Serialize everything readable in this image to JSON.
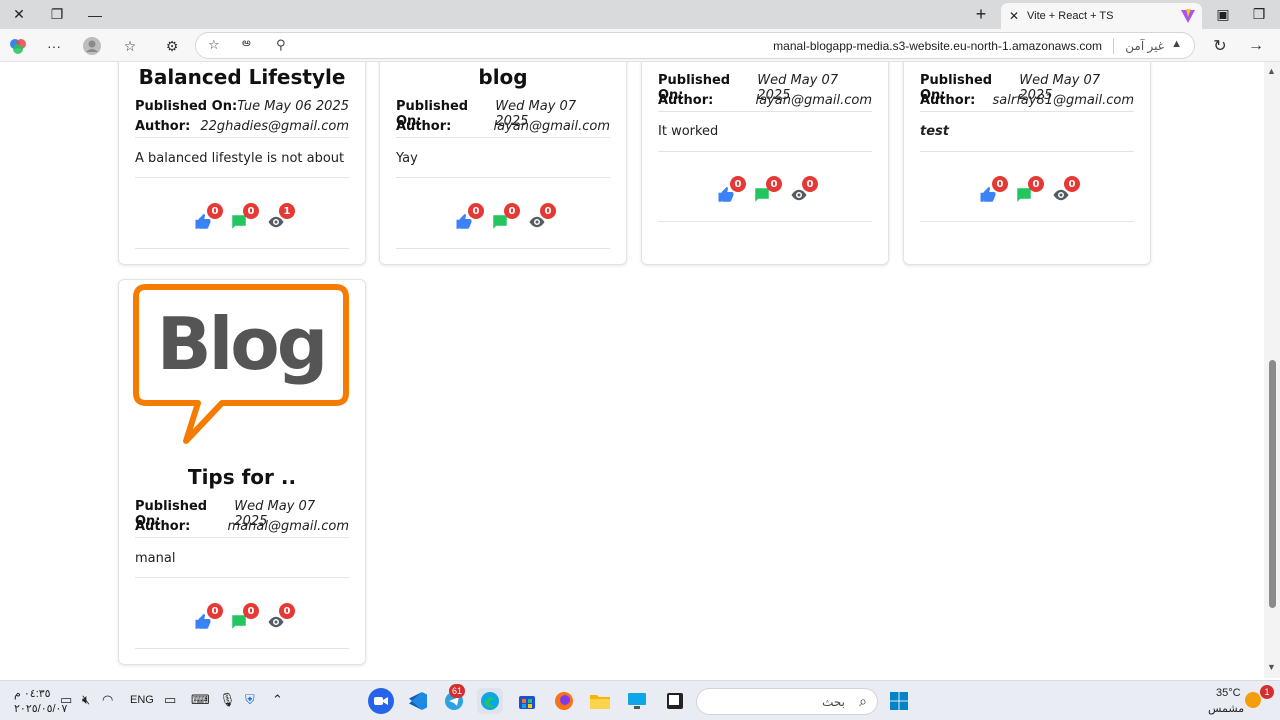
{
  "browser": {
    "tab_title": "Vite + React + TS",
    "url": "manal-blogapp-media.s3-website.eu-north-1.amazonaws.com",
    "security_label": "غير آمن"
  },
  "labels": {
    "published_on": "Published On:",
    "author": "Author:"
  },
  "cards": [
    {
      "title": "Balanced Lifestyle",
      "date": "Tue May 06 2025",
      "author": "22ghadies@gmail.com",
      "excerpt": "A balanced lifestyle is not about ...",
      "likes": "0",
      "comments": "0",
      "views": "1"
    },
    {
      "title": "blog",
      "date": "Wed May 07 2025",
      "author": "layan@gmail.com",
      "excerpt": "Yay",
      "likes": "0",
      "comments": "0",
      "views": "0"
    },
    {
      "title": "",
      "date": "Wed May 07 2025",
      "author": "layan@gmail.com",
      "excerpt": "It worked",
      "likes": "0",
      "comments": "0",
      "views": "0"
    },
    {
      "title": "",
      "date": "Wed May 07 2025",
      "author": "salrfay81@gmail.com",
      "excerpt": "test",
      "likes": "0",
      "comments": "0",
      "views": "0"
    },
    {
      "title": "Tips for ..",
      "date": "Wed May 07 2025",
      "author": "manal@gmail.com",
      "excerpt": "manal",
      "likes": "0",
      "comments": "0",
      "views": "0",
      "image_text": "Blog"
    }
  ],
  "taskbar": {
    "time": "٠٤:٣٥ م",
    "date": "٢٠٢٥/٠٥/٠٧",
    "language": "ENG",
    "search_placeholder": "بحث",
    "weather_temp": "35°C",
    "weather_desc": "مشمس",
    "telegram_badge": "61",
    "weather_badge": "1"
  },
  "colors": {
    "like": "#3b82f6",
    "comment": "#22c55e",
    "view": "#555b63",
    "badge": "#e53935",
    "logo_orange": "#f57c00",
    "logo_gray": "#555555"
  }
}
